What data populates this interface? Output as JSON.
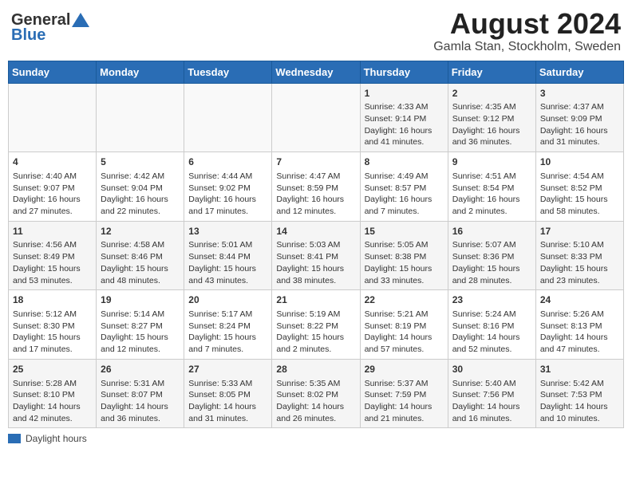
{
  "header": {
    "logo_line1": "General",
    "logo_line2": "Blue",
    "title": "August 2024",
    "subtitle": "Gamla Stan, Stockholm, Sweden"
  },
  "weekdays": [
    "Sunday",
    "Monday",
    "Tuesday",
    "Wednesday",
    "Thursday",
    "Friday",
    "Saturday"
  ],
  "weeks": [
    [
      {
        "day": "",
        "info": ""
      },
      {
        "day": "",
        "info": ""
      },
      {
        "day": "",
        "info": ""
      },
      {
        "day": "",
        "info": ""
      },
      {
        "day": "1",
        "info": "Sunrise: 4:33 AM\nSunset: 9:14 PM\nDaylight: 16 hours and 41 minutes."
      },
      {
        "day": "2",
        "info": "Sunrise: 4:35 AM\nSunset: 9:12 PM\nDaylight: 16 hours and 36 minutes."
      },
      {
        "day": "3",
        "info": "Sunrise: 4:37 AM\nSunset: 9:09 PM\nDaylight: 16 hours and 31 minutes."
      }
    ],
    [
      {
        "day": "4",
        "info": "Sunrise: 4:40 AM\nSunset: 9:07 PM\nDaylight: 16 hours and 27 minutes."
      },
      {
        "day": "5",
        "info": "Sunrise: 4:42 AM\nSunset: 9:04 PM\nDaylight: 16 hours and 22 minutes."
      },
      {
        "day": "6",
        "info": "Sunrise: 4:44 AM\nSunset: 9:02 PM\nDaylight: 16 hours and 17 minutes."
      },
      {
        "day": "7",
        "info": "Sunrise: 4:47 AM\nSunset: 8:59 PM\nDaylight: 16 hours and 12 minutes."
      },
      {
        "day": "8",
        "info": "Sunrise: 4:49 AM\nSunset: 8:57 PM\nDaylight: 16 hours and 7 minutes."
      },
      {
        "day": "9",
        "info": "Sunrise: 4:51 AM\nSunset: 8:54 PM\nDaylight: 16 hours and 2 minutes."
      },
      {
        "day": "10",
        "info": "Sunrise: 4:54 AM\nSunset: 8:52 PM\nDaylight: 15 hours and 58 minutes."
      }
    ],
    [
      {
        "day": "11",
        "info": "Sunrise: 4:56 AM\nSunset: 8:49 PM\nDaylight: 15 hours and 53 minutes."
      },
      {
        "day": "12",
        "info": "Sunrise: 4:58 AM\nSunset: 8:46 PM\nDaylight: 15 hours and 48 minutes."
      },
      {
        "day": "13",
        "info": "Sunrise: 5:01 AM\nSunset: 8:44 PM\nDaylight: 15 hours and 43 minutes."
      },
      {
        "day": "14",
        "info": "Sunrise: 5:03 AM\nSunset: 8:41 PM\nDaylight: 15 hours and 38 minutes."
      },
      {
        "day": "15",
        "info": "Sunrise: 5:05 AM\nSunset: 8:38 PM\nDaylight: 15 hours and 33 minutes."
      },
      {
        "day": "16",
        "info": "Sunrise: 5:07 AM\nSunset: 8:36 PM\nDaylight: 15 hours and 28 minutes."
      },
      {
        "day": "17",
        "info": "Sunrise: 5:10 AM\nSunset: 8:33 PM\nDaylight: 15 hours and 23 minutes."
      }
    ],
    [
      {
        "day": "18",
        "info": "Sunrise: 5:12 AM\nSunset: 8:30 PM\nDaylight: 15 hours and 17 minutes."
      },
      {
        "day": "19",
        "info": "Sunrise: 5:14 AM\nSunset: 8:27 PM\nDaylight: 15 hours and 12 minutes."
      },
      {
        "day": "20",
        "info": "Sunrise: 5:17 AM\nSunset: 8:24 PM\nDaylight: 15 hours and 7 minutes."
      },
      {
        "day": "21",
        "info": "Sunrise: 5:19 AM\nSunset: 8:22 PM\nDaylight: 15 hours and 2 minutes."
      },
      {
        "day": "22",
        "info": "Sunrise: 5:21 AM\nSunset: 8:19 PM\nDaylight: 14 hours and 57 minutes."
      },
      {
        "day": "23",
        "info": "Sunrise: 5:24 AM\nSunset: 8:16 PM\nDaylight: 14 hours and 52 minutes."
      },
      {
        "day": "24",
        "info": "Sunrise: 5:26 AM\nSunset: 8:13 PM\nDaylight: 14 hours and 47 minutes."
      }
    ],
    [
      {
        "day": "25",
        "info": "Sunrise: 5:28 AM\nSunset: 8:10 PM\nDaylight: 14 hours and 42 minutes."
      },
      {
        "day": "26",
        "info": "Sunrise: 5:31 AM\nSunset: 8:07 PM\nDaylight: 14 hours and 36 minutes."
      },
      {
        "day": "27",
        "info": "Sunrise: 5:33 AM\nSunset: 8:05 PM\nDaylight: 14 hours and 31 minutes."
      },
      {
        "day": "28",
        "info": "Sunrise: 5:35 AM\nSunset: 8:02 PM\nDaylight: 14 hours and 26 minutes."
      },
      {
        "day": "29",
        "info": "Sunrise: 5:37 AM\nSunset: 7:59 PM\nDaylight: 14 hours and 21 minutes."
      },
      {
        "day": "30",
        "info": "Sunrise: 5:40 AM\nSunset: 7:56 PM\nDaylight: 14 hours and 16 minutes."
      },
      {
        "day": "31",
        "info": "Sunrise: 5:42 AM\nSunset: 7:53 PM\nDaylight: 14 hours and 10 minutes."
      }
    ]
  ],
  "legend": {
    "label": "Daylight hours"
  }
}
